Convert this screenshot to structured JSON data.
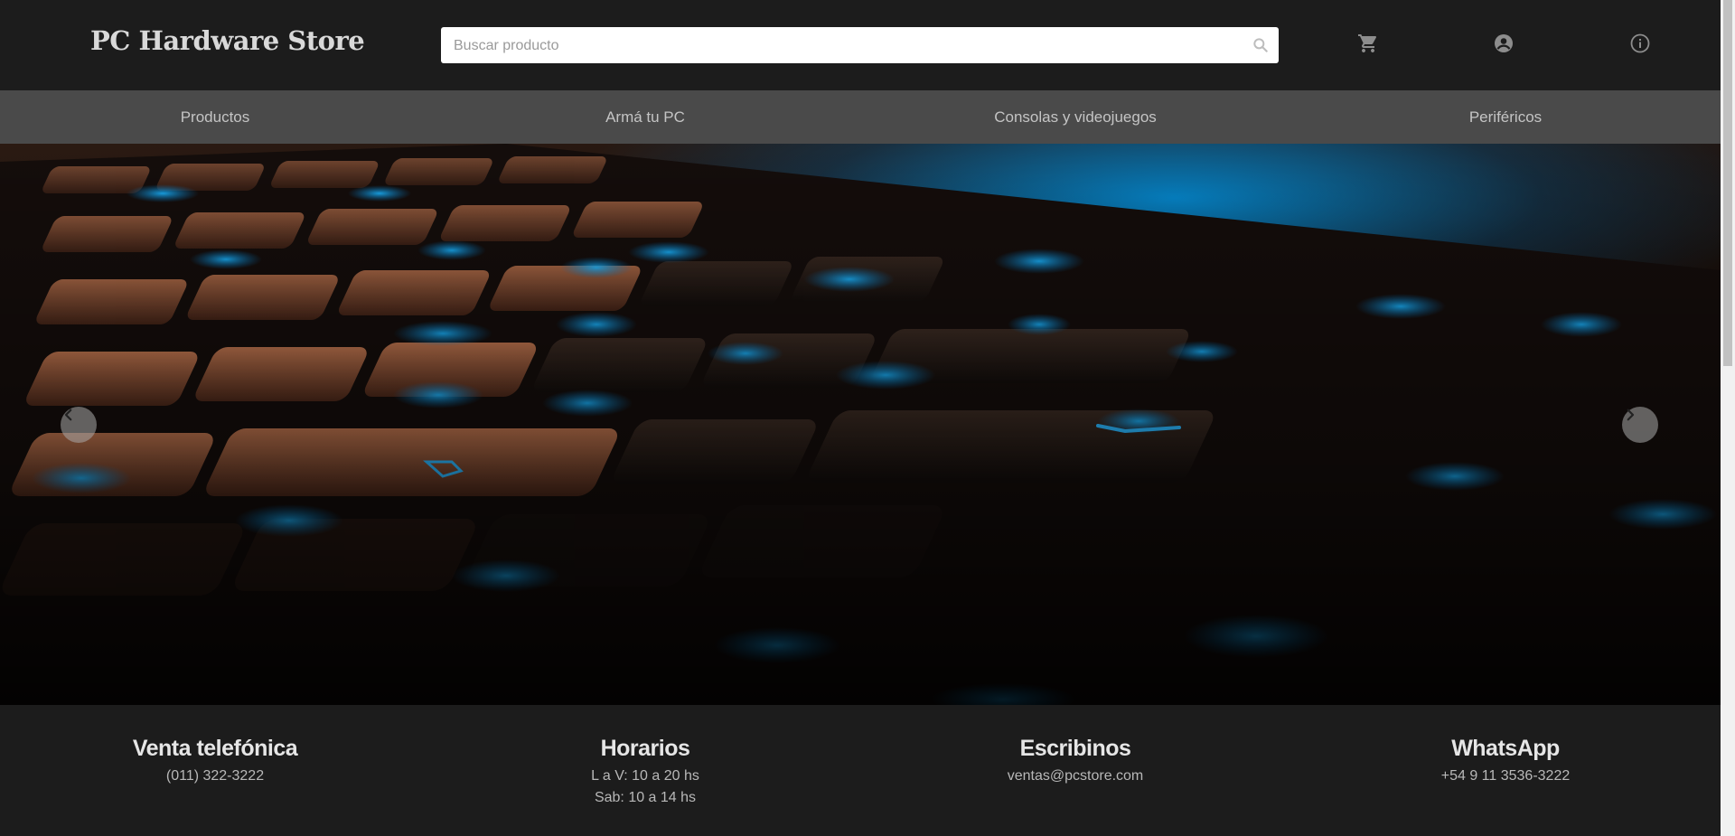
{
  "header": {
    "brand": "PC Hardware Store",
    "search_placeholder": "Buscar producto",
    "icons": [
      "search-icon",
      "cart-icon",
      "account-icon",
      "info-icon"
    ]
  },
  "nav": {
    "items": [
      {
        "label": "Productos"
      },
      {
        "label": "Armá tu PC"
      },
      {
        "label": "Consolas y videojuegos"
      },
      {
        "label": "Periféricos"
      }
    ]
  },
  "hero": {
    "image": "keyboard-backlit-photo",
    "prev_icon": "chevron-left-icon",
    "next_icon": "chevron-right-icon"
  },
  "footer": {
    "columns": [
      {
        "title": "Venta telefónica",
        "lines": [
          "(011) 322-3222"
        ]
      },
      {
        "title": "Horarios",
        "lines": [
          "L a V: 10 a 20 hs",
          "Sab: 10 a 14 hs"
        ]
      },
      {
        "title": "Escribinos",
        "lines": [
          "ventas@pcstore.com"
        ]
      },
      {
        "title": "WhatsApp",
        "lines": [
          "+54 9 11 3536-3222"
        ]
      }
    ]
  },
  "colors": {
    "header_bg": "#1c1c1c",
    "nav_bg": "#4a4a4a",
    "accent_blue": "#0096e6",
    "accent_orange": "#c47a55"
  }
}
